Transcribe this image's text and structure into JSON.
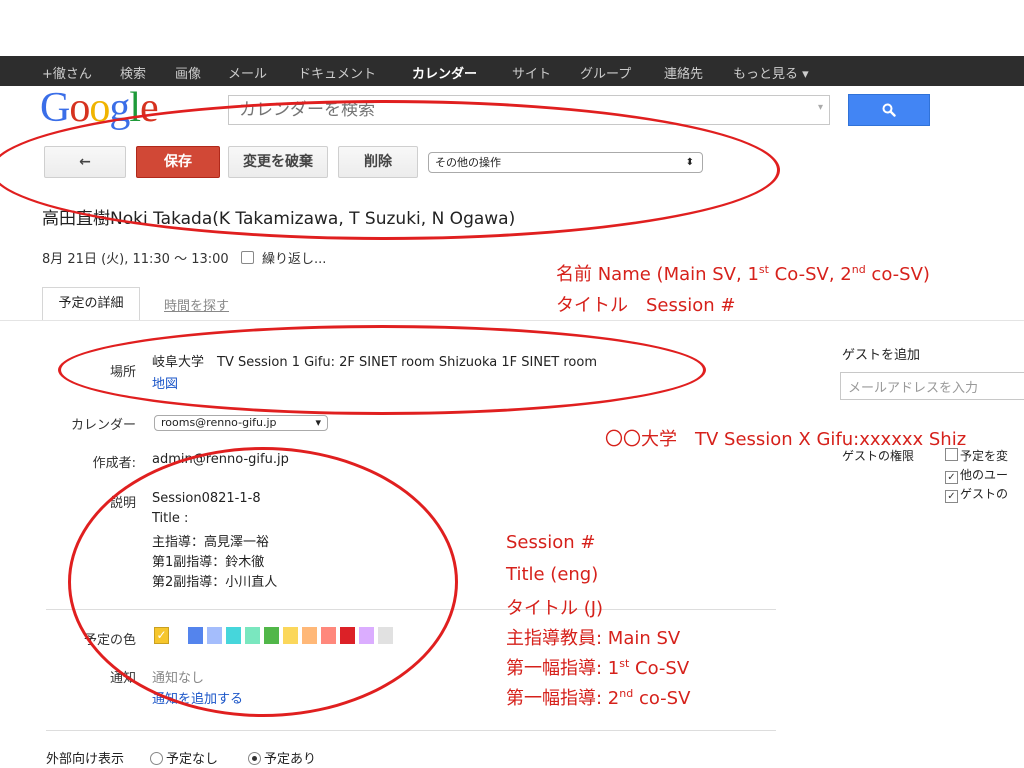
{
  "topnav": {
    "items": [
      "+徹さん",
      "検索",
      "画像",
      "メール",
      "ドキュメント",
      "カレンダー",
      "サイト",
      "グループ",
      "連絡先",
      "もっと見る ▾"
    ],
    "active_index": 5
  },
  "logo": {
    "text": "Google",
    "colors": [
      "#3a6ee8",
      "#d6321f",
      "#f0b400",
      "#3a6ee8",
      "#1e9a39",
      "#d6321f"
    ]
  },
  "search": {
    "placeholder": "カレンダーを検索",
    "caret": "▾",
    "button_icon": "search-icon"
  },
  "toolbar": {
    "back_label": "←",
    "save_label": "保存",
    "discard_label": "変更を破棄",
    "delete_label": "削除",
    "more_actions": "その他の操作",
    "more_caret": "⬍"
  },
  "event": {
    "title": "高田直樹Noki Takada(K Takamizawa, T Suzuki, N Ogawa)",
    "date": "8月 21日 (火), 11:30 ～ 13:00",
    "repeat_label": "繰り返し..."
  },
  "tabs": {
    "details": "予定の詳細",
    "find_time": "時間を探す"
  },
  "form": {
    "location_label": "場所",
    "location_value": "岐阜大学　TV Session 1 Gifu: 2F SINET room Shizuoka 1F SINET room",
    "map_link": "地図",
    "calendar_label": "カレンダー",
    "calendar_value": "rooms@renno-gifu.jp",
    "creator_label": "作成者:",
    "creator_value": "admin@renno-gifu.jp",
    "description_label": "説明",
    "description_lines": [
      "Session0821-1-8",
      "Title :",
      "主指導：高見澤一裕",
      "第1副指導：鈴木徹",
      "第2副指導：小川直人"
    ],
    "color_label": "予定の色",
    "colors": [
      "#f6c62c",
      "#5484ed",
      "#a4bdfc",
      "#46d6db",
      "#7ae7bf",
      "#51b749",
      "#fbd75b",
      "#ffb878",
      "#ff887c",
      "#dc2127",
      "#dbadff",
      "#e1e1e1"
    ],
    "notify_label": "通知",
    "notify_value": "通知なし",
    "add_notify_link": "通知を追加する",
    "visibility_label": "外部向け表示",
    "visibility_none": "予定なし",
    "visibility_busy": "予定あり"
  },
  "guests": {
    "add_label": "ゲストを追加",
    "email_placeholder": "メールアドレスを入力",
    "permissions_label": "ゲストの権限",
    "perm1": "予定を変",
    "perm2": "他のユー",
    "perm3": "ゲストの"
  },
  "annotations": {
    "name_line_a": "名前 Name (Main SV, 1",
    "name_sup1": "st",
    "name_line_b": " Co-SV, 2",
    "name_sup2": "nd",
    "name_line_c": " co-SV)",
    "title_line": "タイトル　Session #",
    "location_template": "〇〇大学　TV Session X Gifu:xxxxxx Shiz",
    "desc_lines": [
      "Session #",
      "Title (eng)",
      "タイトル (J)",
      "主指導教員: Main SV"
    ],
    "co1_a": "第一幅指導: 1",
    "co1_sup": "st",
    "co1_b": " Co-SV",
    "co2_a": "第一幅指導: 2",
    "co2_sup": "nd",
    "co2_b": " co-SV",
    "color": "#d6211b"
  }
}
